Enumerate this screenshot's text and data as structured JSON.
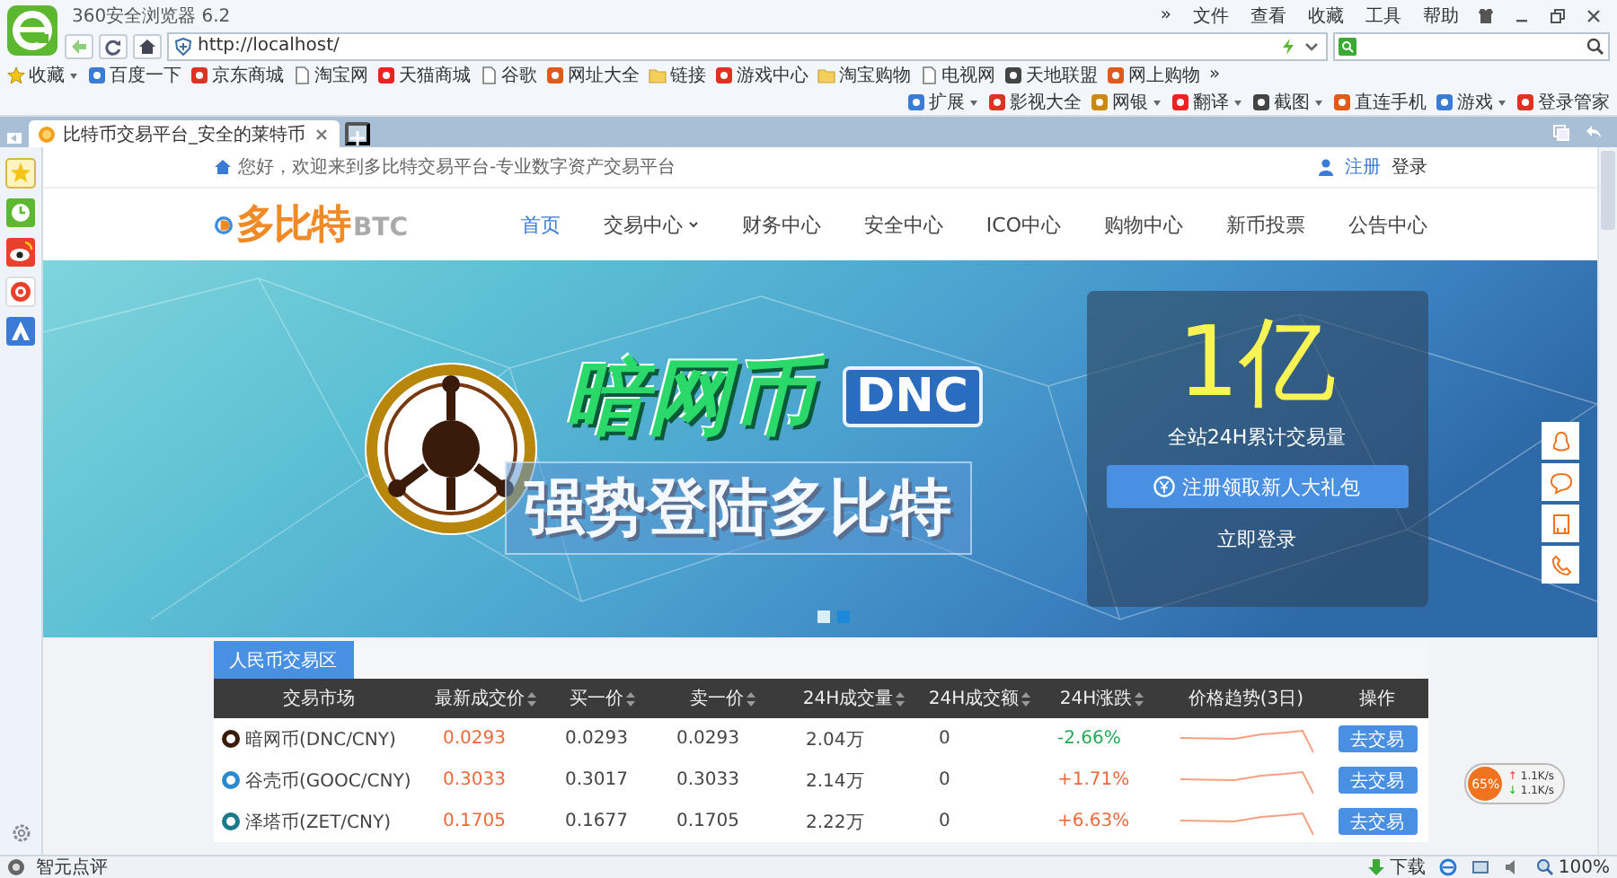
{
  "browser": {
    "title": "360安全浏览器 6.2",
    "menu": [
      "»",
      "文件",
      "查看",
      "收藏",
      "工具",
      "帮助"
    ],
    "address": {
      "url": "http://localhost/"
    },
    "bookmarks": [
      {
        "label": "收藏",
        "kind": "star",
        "has_menu": true
      },
      {
        "label": "百度一下",
        "kind": "app",
        "has_menu": false
      },
      {
        "label": "京东商城",
        "kind": "app",
        "has_menu": false
      },
      {
        "label": "淘宝网",
        "kind": "page",
        "has_menu": false
      },
      {
        "label": "天猫商城",
        "kind": "app",
        "has_menu": false
      },
      {
        "label": "谷歌",
        "kind": "page",
        "has_menu": false
      },
      {
        "label": "网址大全",
        "kind": "app",
        "has_menu": false
      },
      {
        "label": "链接",
        "kind": "folder",
        "has_menu": false
      },
      {
        "label": "游戏中心",
        "kind": "app",
        "has_menu": false
      },
      {
        "label": "淘宝购物",
        "kind": "folder",
        "has_menu": false
      },
      {
        "label": "电视网",
        "kind": "page",
        "has_menu": false
      },
      {
        "label": "天地联盟",
        "kind": "app",
        "has_menu": false
      },
      {
        "label": "网上购物",
        "kind": "app",
        "has_menu": false
      }
    ],
    "bookmarks_more": "»",
    "tools": [
      {
        "label": "扩展",
        "has_menu": true
      },
      {
        "label": "影视大全",
        "has_menu": false
      },
      {
        "label": "网银",
        "has_menu": true
      },
      {
        "label": "翻译",
        "has_menu": true
      },
      {
        "label": "截图",
        "has_menu": true
      },
      {
        "label": "直连手机",
        "has_menu": false
      },
      {
        "label": "游戏",
        "has_menu": true
      },
      {
        "label": "登录管家",
        "has_menu": false
      }
    ],
    "tabs": [
      {
        "label": "比特币交易平台_安全的莱特币",
        "selected": true
      }
    ],
    "status_bar": {
      "left": "智元点评",
      "download": "下载",
      "zoom": "100%"
    }
  },
  "page": {
    "topbar": {
      "greeting": "您好，欢迎来到多比特交易平台-专业数字资产交易平台",
      "links": [
        "注册",
        "登录"
      ]
    },
    "logo": {
      "text": "多比特",
      "suffix": "BTC"
    },
    "nav": [
      {
        "label": "首页",
        "selected": true,
        "has_menu": false
      },
      {
        "label": "交易中心",
        "selected": false,
        "has_menu": true
      },
      {
        "label": "财务中心",
        "selected": false,
        "has_menu": false
      },
      {
        "label": "安全中心",
        "selected": false,
        "has_menu": false
      },
      {
        "label": "ICO中心",
        "selected": false,
        "has_menu": false
      },
      {
        "label": "购物中心",
        "selected": false,
        "has_menu": false
      },
      {
        "label": "新币投票",
        "selected": false,
        "has_menu": false
      },
      {
        "label": "公告中心",
        "selected": false,
        "has_menu": false
      }
    ],
    "banner": {
      "title": "暗网币",
      "tag": "DNC",
      "slogan": "强势登陆多比特",
      "stat": "1亿",
      "stat_label": "全站24H累计交易量",
      "cta": "注册领取新人大礼包",
      "login": "立即登录",
      "dots": [
        {
          "selected": false
        },
        {
          "selected": true
        }
      ]
    },
    "market": {
      "tabs": [
        {
          "label": "人民币交易区",
          "selected": true
        }
      ],
      "columns": [
        {
          "label": "交易市场",
          "sortable": false
        },
        {
          "label": "最新成交价",
          "sortable": true
        },
        {
          "label": "买一价",
          "sortable": true
        },
        {
          "label": "卖一价",
          "sortable": true
        },
        {
          "label": "24H成交量",
          "sortable": true
        },
        {
          "label": "24H成交额",
          "sortable": true
        },
        {
          "label": "24H涨跌",
          "sortable": true
        },
        {
          "label": "价格趋势(3日)",
          "sortable": false
        },
        {
          "label": "操作",
          "sortable": false
        }
      ],
      "rows": [
        {
          "market": "暗网币(DNC/CNY)",
          "last": "0.0293",
          "bid": "0.0293",
          "ask": "0.0293",
          "volume": "2.04万",
          "amount": "0",
          "change": "-2.66%",
          "color": "#22aa55",
          "action": "去交易"
        },
        {
          "market": "谷壳币(GOOC/CNY)",
          "last": "0.3033",
          "bid": "0.3017",
          "ask": "0.3033",
          "volume": "2.14万",
          "amount": "0",
          "change": "+1.71%",
          "color": "#f0683a",
          "action": "去交易"
        },
        {
          "market": "泽塔币(ZET/CNY)",
          "last": "0.1705",
          "bid": "0.1677",
          "ask": "0.1705",
          "volume": "2.22万",
          "amount": "0",
          "change": "+6.63%",
          "color": "#f0683a",
          "action": "去交易"
        }
      ]
    },
    "speed_widget": {
      "percent": "65%",
      "rates": [
        {
          "arrow": "↑",
          "value": "1.1K/s"
        },
        {
          "arrow": "↓",
          "value": "1.1K/s"
        }
      ]
    }
  }
}
